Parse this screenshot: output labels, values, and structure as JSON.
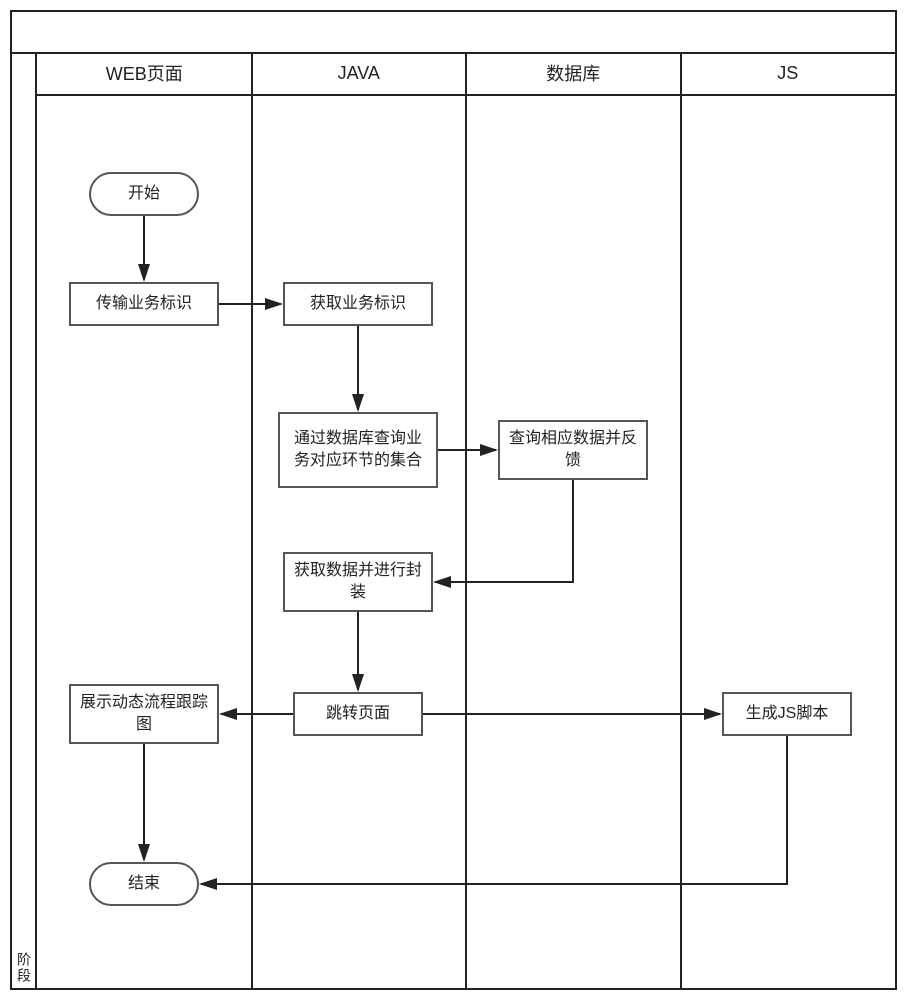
{
  "side_label": "阶段",
  "lanes": {
    "l1": "WEB页面",
    "l2": "JAVA",
    "l3": "数据库",
    "l4": "JS"
  },
  "nodes": {
    "start": "开始",
    "n1": "传输业务标识",
    "n2": "获取业务标识",
    "n3": "通过数据库查询业务对应环节的集合",
    "n4": "查询相应数据并反馈",
    "n5": "获取数据并进行封装",
    "n6": "跳转页面",
    "n7": "生成JS脚本",
    "n8": "展示动态流程跟踪图",
    "end": "结束"
  },
  "chart_data": {
    "type": "flowchart-swimlane",
    "orientation": "vertical",
    "lanes": [
      "WEB页面",
      "JAVA",
      "数据库",
      "JS"
    ],
    "nodes": [
      {
        "id": "start",
        "lane": "WEB页面",
        "type": "terminator",
        "label": "开始"
      },
      {
        "id": "n1",
        "lane": "WEB页面",
        "type": "process",
        "label": "传输业务标识"
      },
      {
        "id": "n2",
        "lane": "JAVA",
        "type": "process",
        "label": "获取业务标识"
      },
      {
        "id": "n3",
        "lane": "JAVA",
        "type": "process",
        "label": "通过数据库查询业务对应环节的集合"
      },
      {
        "id": "n4",
        "lane": "数据库",
        "type": "process",
        "label": "查询相应数据并反馈"
      },
      {
        "id": "n5",
        "lane": "JAVA",
        "type": "process",
        "label": "获取数据并进行封装"
      },
      {
        "id": "n6",
        "lane": "JAVA",
        "type": "process",
        "label": "跳转页面"
      },
      {
        "id": "n7",
        "lane": "JS",
        "type": "process",
        "label": "生成JS脚本"
      },
      {
        "id": "n8",
        "lane": "WEB页面",
        "type": "process",
        "label": "展示动态流程跟踪图"
      },
      {
        "id": "end",
        "lane": "WEB页面",
        "type": "terminator",
        "label": "结束"
      }
    ],
    "edges": [
      {
        "from": "start",
        "to": "n1"
      },
      {
        "from": "n1",
        "to": "n2"
      },
      {
        "from": "n2",
        "to": "n3"
      },
      {
        "from": "n3",
        "to": "n4"
      },
      {
        "from": "n4",
        "to": "n5"
      },
      {
        "from": "n5",
        "to": "n6"
      },
      {
        "from": "n6",
        "to": "n8"
      },
      {
        "from": "n6",
        "to": "n7"
      },
      {
        "from": "n8",
        "to": "end"
      },
      {
        "from": "n7",
        "to": "end"
      }
    ]
  }
}
